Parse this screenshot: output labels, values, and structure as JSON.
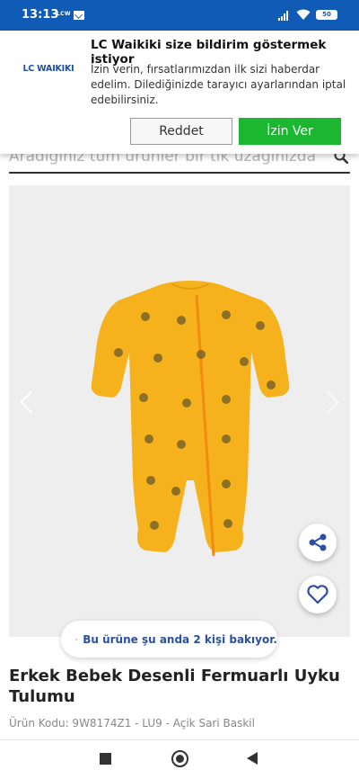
{
  "status_bar": {
    "time": "13:13",
    "carrier_badge": "LCW",
    "battery": "50"
  },
  "search": {
    "placeholder": "Aradığınız tüm ürünler bir tık uzağınızda"
  },
  "notification": {
    "logo_text": "LC WAIKIKI",
    "title": "LC Waikiki size bildirim göstermek istiyor",
    "body": "İzin verin, fırsatlarımızdan ilk sizi haberdar edelim. Dilediğinizde tarayıcı ayarlarından iptal edebilirsiniz.",
    "reject_label": "Reddet",
    "allow_label": "İzin Ver",
    "allow_color": "#1bb730"
  },
  "product": {
    "viewers_text": "Bu ürüne şu anda 2 kişi bakıyor.",
    "title": "Erkek Bebek Desenli Fermuarlı Uyku Tulumu",
    "code": "Ürün Kodu: 9W8174Z1 - LU9 - Açik Sari Baskil",
    "image_color": "#f6b21c"
  },
  "icons": {
    "share": "share-icon",
    "favorite": "heart-icon",
    "viewers": "eye-icon"
  }
}
